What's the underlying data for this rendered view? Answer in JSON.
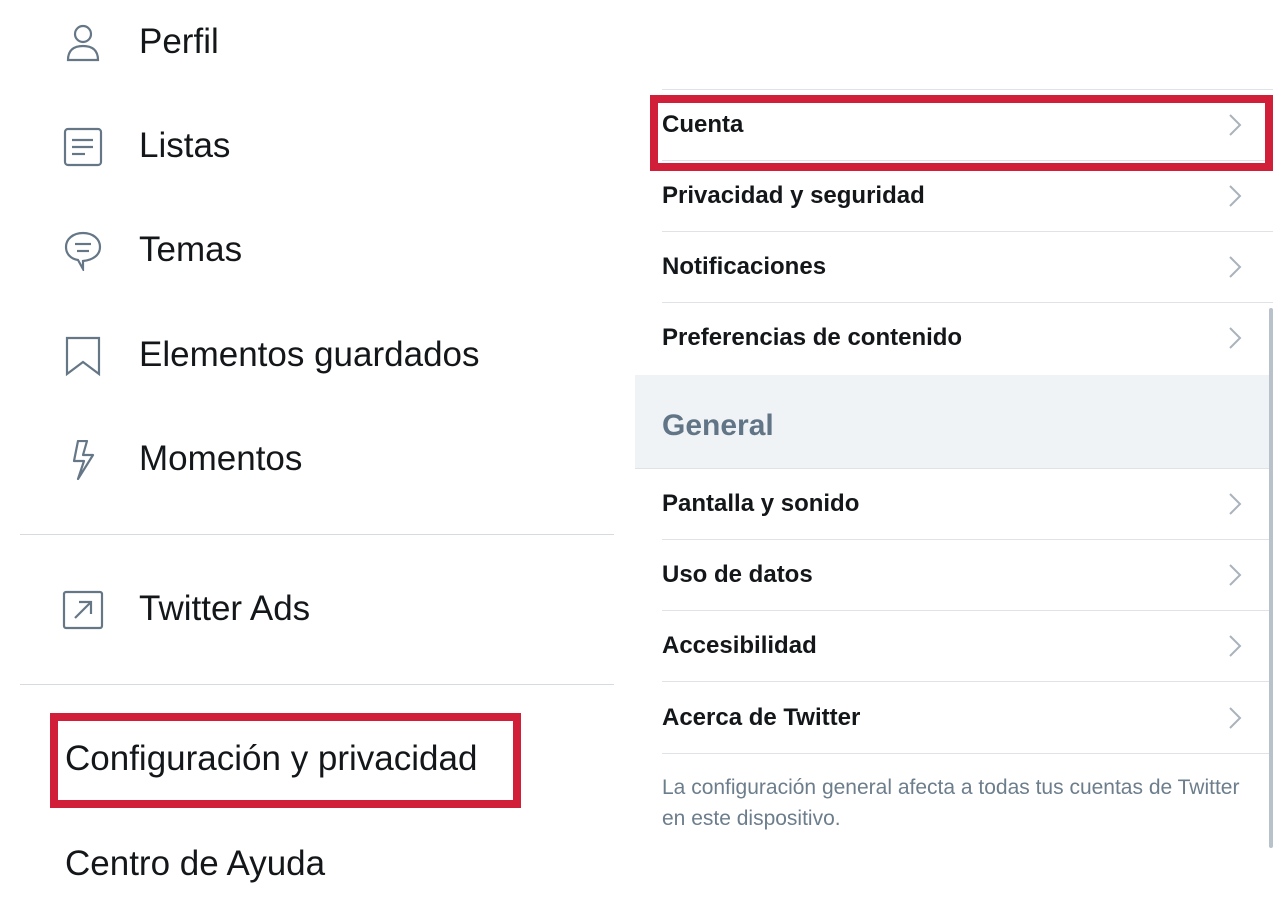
{
  "left_menu": {
    "items": [
      {
        "label": "Perfil",
        "icon": "person-icon"
      },
      {
        "label": "Listas",
        "icon": "list-icon"
      },
      {
        "label": "Temas",
        "icon": "topics-icon"
      },
      {
        "label": "Elementos guardados",
        "icon": "bookmark-icon"
      },
      {
        "label": "Momentos",
        "icon": "lightning-icon"
      }
    ],
    "ads_item": {
      "label": "Twitter Ads",
      "icon": "external-link-icon"
    },
    "settings_item": {
      "label": "Configuración y privacidad"
    },
    "help_item": {
      "label": "Centro de Ayuda"
    }
  },
  "settings": {
    "account_rows": [
      {
        "label": "Cuenta"
      },
      {
        "label": "Privacidad y seguridad"
      },
      {
        "label": "Notificaciones"
      },
      {
        "label": "Preferencias de contenido"
      }
    ],
    "general_header": "General",
    "general_rows": [
      {
        "label": "Pantalla y sonido"
      },
      {
        "label": "Uso de datos"
      },
      {
        "label": "Accesibilidad"
      },
      {
        "label": "Acerca de Twitter"
      }
    ],
    "footnote": "La configuración general afecta a todas tus cuentas de Twitter en este dispositivo."
  },
  "colors": {
    "highlight": "#d11e39",
    "text": "#14171a",
    "icon": "#657786",
    "section_bg": "#eff3f5",
    "section_text": "#627587"
  }
}
